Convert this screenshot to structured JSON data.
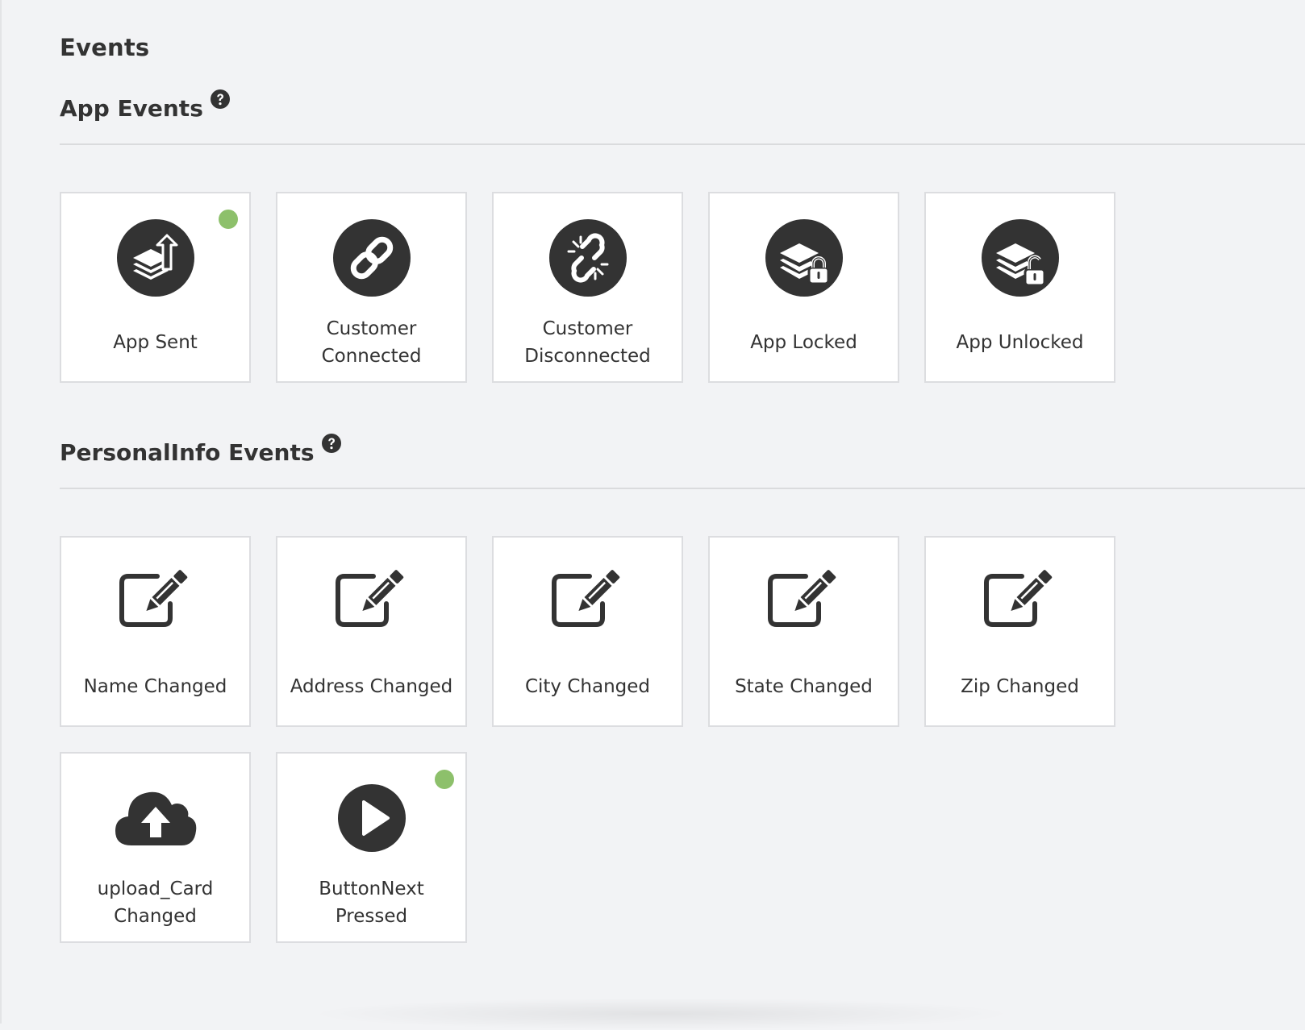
{
  "page_title": "Events",
  "colors": {
    "background": "#f2f3f5",
    "tile_background": "#ffffff",
    "tile_border": "#dcdde0",
    "icon": "#333333",
    "active_dot": "#8dc06b"
  },
  "sections": [
    {
      "title": "App Events",
      "help_icon": "question-circle-icon",
      "tiles": [
        {
          "label": "App Sent",
          "icon": "layers-upload-icon",
          "active": true
        },
        {
          "label": "Customer Connected",
          "icon": "link-icon",
          "active": false
        },
        {
          "label": "Customer Disconnected",
          "icon": "unlink-icon",
          "active": false
        },
        {
          "label": "App Locked",
          "icon": "layers-lock-icon",
          "active": false
        },
        {
          "label": "App Unlocked",
          "icon": "layers-unlock-icon",
          "active": false
        }
      ]
    },
    {
      "title": "PersonalInfo Events",
      "help_icon": "question-circle-icon",
      "tiles": [
        {
          "label": "Name Changed",
          "icon": "edit-icon",
          "active": false
        },
        {
          "label": "Address Changed",
          "icon": "edit-icon",
          "active": false
        },
        {
          "label": "City Changed",
          "icon": "edit-icon",
          "active": false
        },
        {
          "label": "State Changed",
          "icon": "edit-icon",
          "active": false
        },
        {
          "label": "Zip Changed",
          "icon": "edit-icon",
          "active": false
        },
        {
          "label": "upload_Card Changed",
          "icon": "cloud-upload-icon",
          "active": false
        },
        {
          "label": "ButtonNext Pressed",
          "icon": "play-circle-icon",
          "active": true
        }
      ]
    }
  ]
}
